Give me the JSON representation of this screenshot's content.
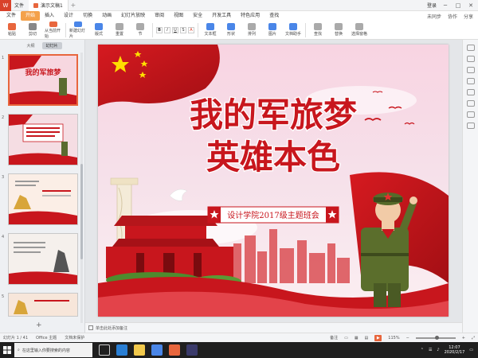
{
  "window": {
    "tab_label": "文件",
    "doc_tab": "演示文稿1",
    "account": "登录"
  },
  "menubar": {
    "items": [
      "文件",
      "开始",
      "插入",
      "设计",
      "切换",
      "动画",
      "幻灯片放映",
      "审阅",
      "视图",
      "安全",
      "开发工具",
      "特色应用",
      "查找"
    ],
    "active_index": 1,
    "right_items": [
      "未同步",
      "协作",
      "分享"
    ]
  },
  "ribbon": {
    "buttons": [
      {
        "label": "粘贴",
        "color": "#e8663d"
      },
      {
        "label": "剪切",
        "color": "#888888"
      },
      {
        "label": "从当前开始",
        "color": "#e8663d"
      },
      {
        "label": "新建幻灯片",
        "color": "#4a86e8"
      },
      {
        "label": "版式",
        "color": "#4a86e8"
      },
      {
        "label": "重置",
        "color": "#888888"
      },
      {
        "label": "节",
        "color": "#888888"
      },
      {
        "label": "文本框",
        "color": "#4a86e8"
      },
      {
        "label": "形状",
        "color": "#4a86e8"
      },
      {
        "label": "排列",
        "color": "#888888"
      },
      {
        "label": "图片",
        "color": "#4a86e8"
      },
      {
        "label": "文档助手",
        "color": "#4a86e8"
      },
      {
        "label": "查找",
        "color": "#888888"
      },
      {
        "label": "替换",
        "color": "#888888"
      },
      {
        "label": "选择窗格",
        "color": "#888888"
      }
    ],
    "format_letters": [
      "B",
      "I",
      "U",
      "S",
      "A"
    ]
  },
  "leftpane": {
    "tabs": [
      "大纲",
      "幻灯片"
    ],
    "active_tab": 1,
    "thumbnails": [
      {
        "num": "1",
        "label": "我的军旅梦"
      },
      {
        "num": "2",
        "label": ""
      },
      {
        "num": "3",
        "label": ""
      },
      {
        "num": "4",
        "label": ""
      },
      {
        "num": "5",
        "label": ""
      }
    ]
  },
  "slide": {
    "title_line1": "我的军旅梦",
    "title_line2": "英雄本色",
    "subtitle": "设计学院2017级主题班会"
  },
  "notes": {
    "label": "单击此处添加备注"
  },
  "status": {
    "slide_count": "幻灯片 1 / 41",
    "theme": "Office 主题",
    "doc_protect": "文档未保护",
    "notes_toggle": "备注",
    "zoom": "115%"
  },
  "taskbar": {
    "search_placeholder": "在这里输入你要搜索的内容",
    "time": "12:07",
    "date": "2020/2/17"
  },
  "colors": {
    "accent": "#e8663d",
    "slide_red": "#c8161d",
    "gold": "#f2c94c"
  }
}
